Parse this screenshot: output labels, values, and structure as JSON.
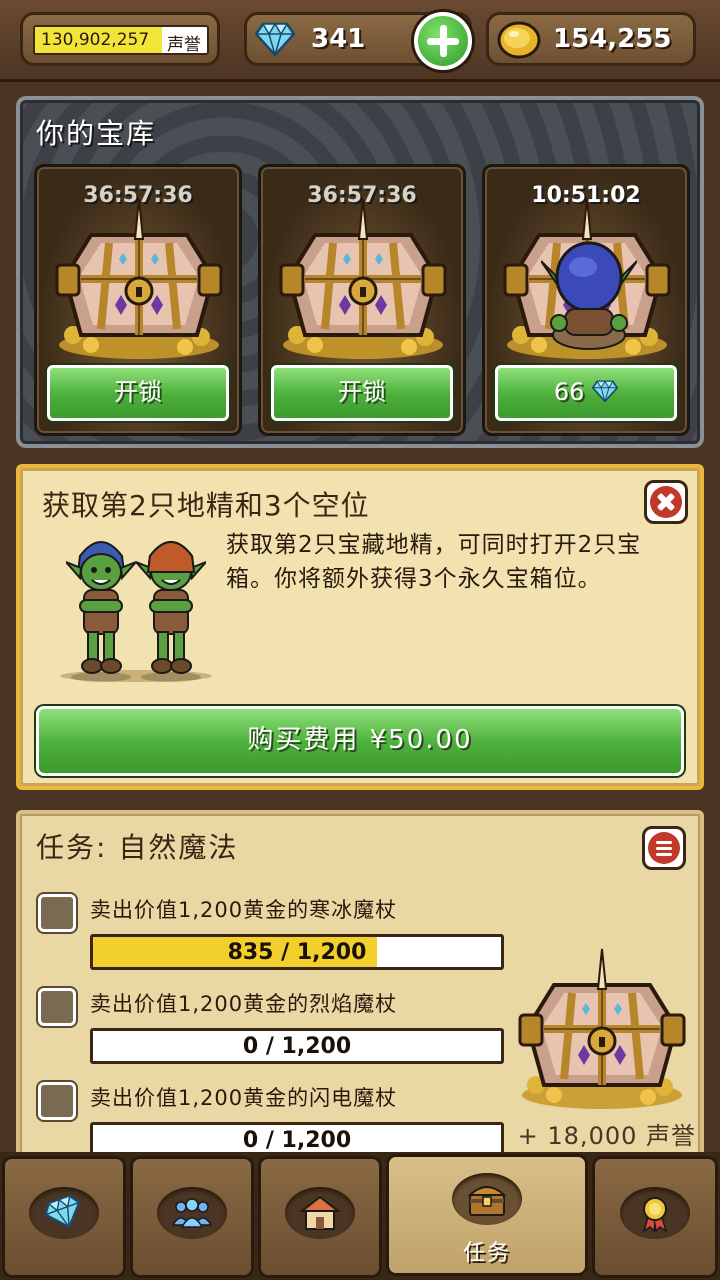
{
  "topbar": {
    "reputation": {
      "value": "130,902,257",
      "suffix": "声誉",
      "fill": 0.74
    },
    "gems": "341",
    "gold": "154,255"
  },
  "vault": {
    "title": "你的宝库",
    "slots": [
      {
        "timer": "36:57:36",
        "button": "开锁"
      },
      {
        "timer": "36:57:36",
        "button": "开锁"
      },
      {
        "timer": "10:51:02",
        "button": "66"
      }
    ]
  },
  "offer": {
    "title": "获取第2只地精和3个空位",
    "description": "获取第2只宝藏地精，可同时打开2只宝箱。你将额外获得3个永久宝箱位。",
    "buy_label": "购买费用 ¥50.00"
  },
  "quest": {
    "title": "任务: 自然魔法",
    "tasks": [
      {
        "label": "卖出价值1,200黄金的寒冰魔杖",
        "progress": "835 / 1,200",
        "fraction": 0.696
      },
      {
        "label": "卖出价值1,200黄金的烈焰魔杖",
        "progress": "0 / 1,200",
        "fraction": 0
      },
      {
        "label": "卖出价值1,200黄金的闪电魔杖",
        "progress": "0 / 1,200",
        "fraction": 0
      }
    ],
    "reward": "+ 18,000 声誉"
  },
  "nav": {
    "tabs": [
      {
        "icon": "gem-icon",
        "label": ""
      },
      {
        "icon": "people-icon",
        "label": ""
      },
      {
        "icon": "shop-icon",
        "label": ""
      },
      {
        "icon": "chest-icon",
        "label": "任务",
        "active": true
      },
      {
        "icon": "medal-icon",
        "label": ""
      }
    ]
  },
  "colors": {
    "accent_green": "#4caf3a",
    "progress_yellow": "#f2cf2c",
    "close_red": "#c0392b",
    "offer_border": "#e8b93a"
  }
}
